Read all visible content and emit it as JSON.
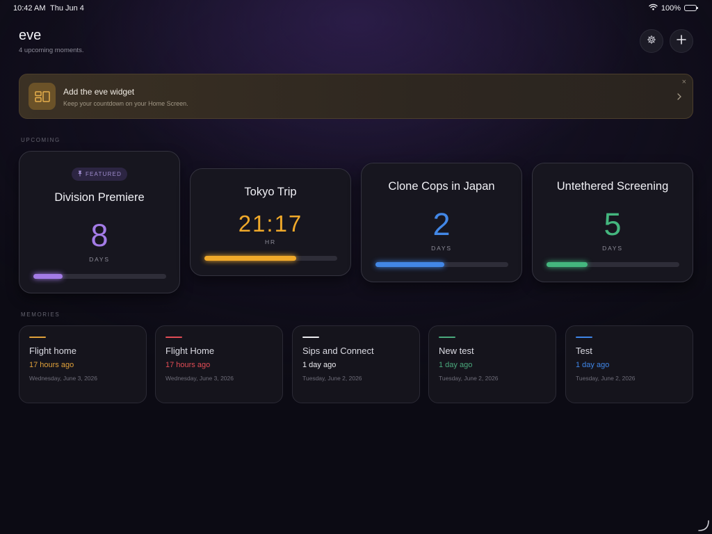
{
  "status_bar": {
    "time": "10:42 AM",
    "date": "Thu Jun 4",
    "battery": "100%"
  },
  "header": {
    "title": "eve",
    "subtitle": "4 upcoming moments."
  },
  "banner": {
    "title": "Add the eve widget",
    "subtitle": "Keep your countdown on your Home Screen.",
    "close": "×"
  },
  "upcoming": {
    "label": "UPCOMING",
    "events": [
      {
        "title": "Division Premiere",
        "badge": "FEATURED",
        "value": "8",
        "unit": "DAYS",
        "progress": 0.22,
        "color": "#a37be6"
      },
      {
        "title": "Tokyo Trip",
        "value": "21:17",
        "unit": "HR",
        "progress": 0.69,
        "color": "#f0a92a"
      },
      {
        "title": "Clone Cops in Japan",
        "value": "2",
        "unit": "DAYS",
        "progress": 0.52,
        "color": "#4287e6"
      },
      {
        "title": "Untethered Screening",
        "value": "5",
        "unit": "DAYS",
        "progress": 0.31,
        "color": "#44b67e"
      }
    ]
  },
  "memories": {
    "label": "MEMORIES",
    "items": [
      {
        "title": "Flight home",
        "ago": "17 hours ago",
        "date": "Wednesday, June 3, 2026",
        "color": "#e0a13a"
      },
      {
        "title": "Flight Home",
        "ago": "17 hours ago",
        "date": "Wednesday, June 3, 2026",
        "color": "#e24c55"
      },
      {
        "title": "Sips and Connect",
        "ago": "1 day ago",
        "date": "Tuesday, June 2, 2026",
        "color": "#ececf0"
      },
      {
        "title": "New test",
        "ago": "1 day ago",
        "date": "Tuesday, June 2, 2026",
        "color": "#4aaa7d"
      },
      {
        "title": "Test",
        "ago": "1 day ago",
        "date": "Tuesday, June 2, 2026",
        "color": "#3f86e8"
      }
    ]
  },
  "icons": {
    "settings": "gear-icon",
    "add": "plus-icon",
    "widget": "widget-icon",
    "banner_chevron": "chevron-right-icon",
    "featured": "pin-icon"
  }
}
